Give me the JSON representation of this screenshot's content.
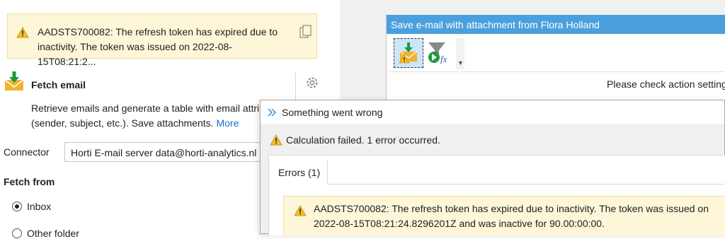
{
  "settings": {
    "error_banner": "AADSTS700082: The refresh token has expired due to inactivity. The token was issued on 2022-08-15T08:21:2...",
    "action_title": "Fetch email",
    "description": "Retrieve emails and generate a table with email attri",
    "description_line2": "(sender, subject, etc.). Save attachments.",
    "more_link": "More",
    "connector_label": "Connector",
    "connector_value": "Horti E-mail server data@horti-analytics.nl",
    "fetch_from_label": "Fetch from",
    "options": [
      {
        "label": "Inbox",
        "selected": true
      },
      {
        "label": "Other folder",
        "selected": false
      }
    ]
  },
  "background_window": {
    "title": "Save e-mail with attachment from Flora Holland",
    "message": "Please check action setting"
  },
  "dialog": {
    "title": "Something went wrong",
    "summary": "Calculation failed. 1 error occurred.",
    "tab_label": "Errors (1)",
    "error_line1": "AADSTS700082: The refresh token has expired due to inactivity. The token was issued on",
    "error_line2": "2022-08-15T08:21:24.8296201Z and was inactive for 90.00:00:00."
  },
  "colors": {
    "accent": "#4aa0de",
    "warning_bg": "#fdf6d8",
    "link": "#1a6fd0"
  }
}
